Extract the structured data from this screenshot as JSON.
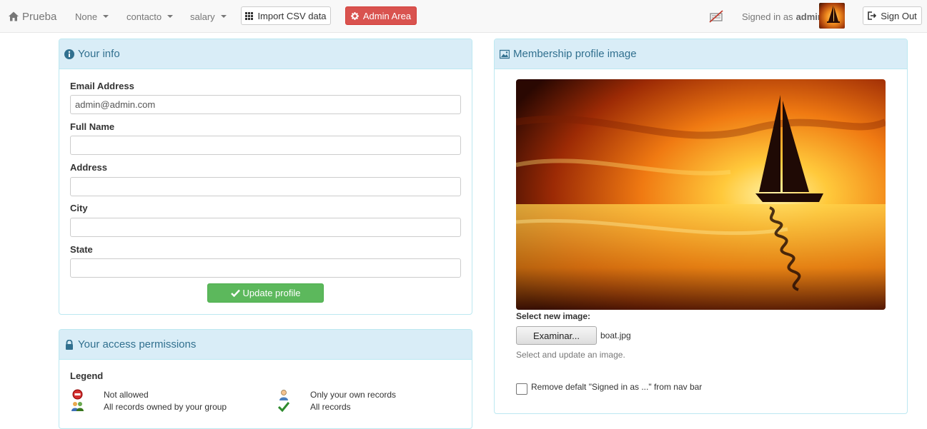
{
  "navbar": {
    "brand": "Prueba",
    "menus": [
      {
        "label": "None"
      },
      {
        "label": "contacto"
      },
      {
        "label": "salary"
      }
    ],
    "import_label": "Import CSV data",
    "admin_label": "Admin Area",
    "signed_in_prefix": "Signed in as",
    "username": "admin",
    "signout_label": "Sign Out"
  },
  "your_info": {
    "title": "Your info",
    "fields": {
      "email": {
        "label": "Email Address",
        "value": "admin@admin.com"
      },
      "fullname": {
        "label": "Full Name",
        "value": ""
      },
      "address": {
        "label": "Address",
        "value": ""
      },
      "city": {
        "label": "City",
        "value": ""
      },
      "state": {
        "label": "State",
        "value": ""
      }
    },
    "update_label": "Update profile"
  },
  "permissions": {
    "title": "Your access permissions",
    "legend_title": "Legend",
    "legend": [
      {
        "label": "Not allowed",
        "icon": "no-entry-icon"
      },
      {
        "label": "Only your own records",
        "icon": "user-icon"
      },
      {
        "label": "All records owned by your group",
        "icon": "group-icon"
      },
      {
        "label": "All records",
        "icon": "check-icon"
      }
    ]
  },
  "profile_image": {
    "title": "Membership profile image",
    "select_label": "Select new image:",
    "browse_label": "Examinar...",
    "file_name": "boat.jpg",
    "help": "Select and update an image.",
    "remove_label": "Remove defalt \"Signed in as ...\" from nav bar",
    "remove_checked": false
  }
}
